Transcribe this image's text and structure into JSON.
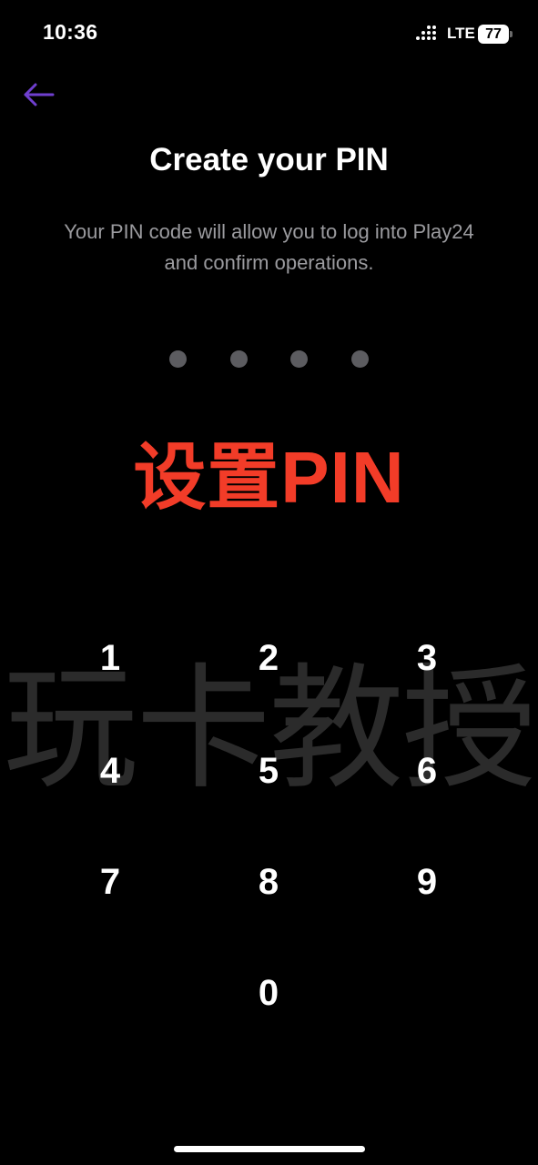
{
  "status_bar": {
    "time": "10:36",
    "network": "LTE",
    "battery": "77"
  },
  "header": {
    "back_icon": "arrow-left-icon",
    "accent_color": "#6f3fcf"
  },
  "main": {
    "title": "Create your PIN",
    "subtitle_line1": "Your PIN code will allow you to log into Play24",
    "subtitle_line2": "and confirm operations.",
    "pin_length": 4,
    "entered_digits": 0
  },
  "overlay": {
    "caption": "设置PIN",
    "caption_color": "#f23c28",
    "watermark": "玩卡教授"
  },
  "keypad": {
    "keys": [
      "1",
      "2",
      "3",
      "4",
      "5",
      "6",
      "7",
      "8",
      "9",
      "0"
    ]
  }
}
